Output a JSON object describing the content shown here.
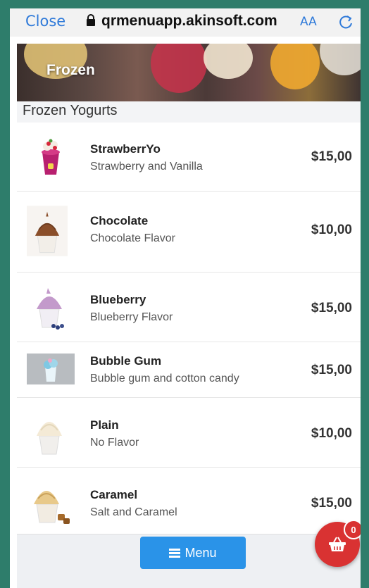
{
  "browser": {
    "close_label": "Close",
    "url": "qrmenuapp.akinsoft.com",
    "text_size_label": "AA"
  },
  "hero": {
    "title": "Frozen"
  },
  "category": {
    "title": "Frozen Yogurts"
  },
  "items": [
    {
      "name": "StrawberrYo",
      "description": "Strawberry and Vanilla",
      "price": "$15,00",
      "thumb": "strawberry-cup"
    },
    {
      "name": "Chocolate",
      "description": "Chocolate Flavor",
      "price": "$10,00",
      "thumb": "chocolate-cone"
    },
    {
      "name": "Blueberry",
      "description": "Blueberry Flavor",
      "price": "$15,00",
      "thumb": "blueberry-cup"
    },
    {
      "name": "Bubble Gum",
      "description": "Bubble gum and cotton candy",
      "price": "$15,00",
      "thumb": "bubblegum-cup"
    },
    {
      "name": "Plain",
      "description": "No Flavor",
      "price": "$10,00",
      "thumb": "plain-cup"
    },
    {
      "name": "Caramel",
      "description": "Salt and Caramel",
      "price": "$15,00",
      "thumb": "caramel-cup"
    }
  ],
  "bottom": {
    "menu_label": "Menu"
  },
  "cart": {
    "count": "0"
  },
  "colors": {
    "accent": "#2a93e8",
    "cart": "#d93232",
    "link": "#2f7ad9"
  }
}
